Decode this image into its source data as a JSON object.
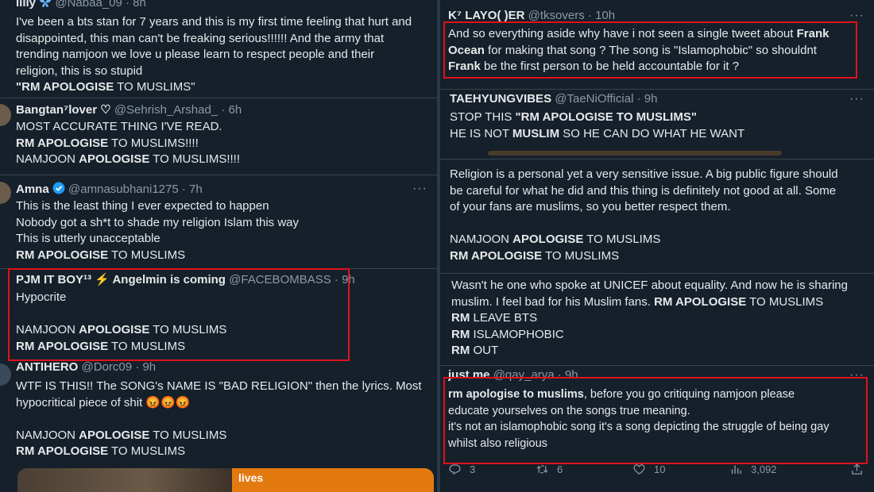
{
  "left": {
    "t1": {
      "name": "lilly",
      "handle": "@Nabaa_09",
      "time": "8h",
      "lines": [
        "I've been a bts stan for 7 years and this is my first time feeling that hurt and",
        "disappointed, this man can't be freaking serious!!!!!! And the army that",
        "trending namjoon we love u please learn to respect people and their",
        "religion, this is so stupid"
      ],
      "last_bold": "\"RM APOLOGISE",
      "last_rest": " TO MUSLIMS\""
    },
    "t2": {
      "name": "Bangtan⁷lover ♡",
      "handle": "@Sehrish_Arshad_",
      "time": "6h",
      "line1": "MOST ACCURATE THING I'VE READ.",
      "line2_bold": "RM APOLOGISE",
      "line2_rest": " TO MUSLIMS!!!!",
      "line3_a": "NAMJOON ",
      "line3_bold": "APOLOGISE",
      "line3_rest": " TO MUSLIMS!!!!"
    },
    "t3": {
      "name": "Amna",
      "handle": "@amnasubhani1275",
      "time": "7h",
      "line1": "This is the least thing I ever expected to happen",
      "line2": "Nobody got a sh*t to shade my religion Islam this way",
      "line3": "This is utterly unacceptable",
      "line4_bold": "RM APOLOGISE",
      "line4_rest": " TO MUSLIMS"
    },
    "t4": {
      "name": "PJM IT BOY¹³ ⚡ Angelmin is coming",
      "handle": "@FACEBOMBASS",
      "time": "9h",
      "line1": "Hypocrite",
      "line2_a": "NAMJOON ",
      "line2_bold": "APOLOGISE",
      "line2_rest": " TO MUSLIMS",
      "line3_bold": "RM APOLOGISE",
      "line3_rest": " TO MUSLIMS"
    },
    "t5": {
      "name": "ANTIHERO",
      "handle": "@Dorc09",
      "time": "9h",
      "line1": "WTF IS THIS!!  The SONG's NAME IS \"BAD RELIGION\" then the lyrics. Most",
      "line2": "hypocritical piece of shit 😡😡😡",
      "line3_a": "NAMJOON ",
      "line3_bold": "APOLOGISE",
      "line3_rest": " TO MUSLIMS",
      "line4_bold": "RM APOLOGISE",
      "line4_rest": " TO MUSLIMS",
      "media_label": "lives"
    }
  },
  "right": {
    "r1": {
      "name": "K⁷ LAYO(  )ER",
      "handle": "@tksovers",
      "time": "10h",
      "l1_a": "And so everything aside why have i not seen a single tweet about ",
      "l1_bold": "Frank",
      "l2_bold": "Ocean",
      "l2_rest": " for making that song ? The song is \"Islamophobic\" so shouldnt",
      "l3_bold": "Frank",
      "l3_rest": " be the first person to be held accountable for it ?"
    },
    "r2": {
      "name": "TAEHYUNGVIBES",
      "handle": "@TaeNiOfficial",
      "time": "9h",
      "l1_a": "STOP THIS ",
      "l1_bold": "\"RM APOLOGISE TO MUSLIMS\"",
      "l2_a": "HE IS NOT ",
      "l2_bold": "MUSLIM",
      "l2_rest": " SO HE CAN DO WHAT HE WANT"
    },
    "r3": {
      "lines": [
        "Religion is a personal yet a very sensitive issue. A big public figure should",
        "be careful for what he did and this thing is definitely not good at all. Some",
        "of your fans are muslims, so you better respect them."
      ],
      "l4_a": "NAMJOON ",
      "l4_bold": "APOLOGISE",
      "l4_rest": " TO MUSLIMS",
      "l5_bold": "RM APOLOGISE",
      "l5_rest": " TO MUSLIMS"
    },
    "r4": {
      "l1": "Wasn't he one who spoke at UNICEF about equality. And now he is sharing",
      "l2_a": "muslim. I feel bad for his Muslim fans. ",
      "l2_bold": "RM APOLOGISE",
      "l2_rest": " TO MUSLIMS",
      "l3_bold": "RM",
      "l3_rest": " LEAVE BTS",
      "l4_bold": "RM",
      "l4_rest": " ISLAMOPHOBIC",
      "l5_bold": "RM",
      "l5_rest": " OUT"
    },
    "r5": {
      "name": "just me",
      "handle": "@qay_arya",
      "time": "9h",
      "l1_bold": "rm apologise to muslims",
      "l1_rest": ", before you go critiquing namjoon please",
      "l2": "educate yourselves on the songs true meaning.",
      "l3": "it's not an islamophobic song it's a song depicting the struggle of being gay",
      "l4": "whilst also religious",
      "replies": "3",
      "retweets": "6",
      "likes": "10",
      "views": "3,092"
    }
  },
  "colors": {
    "highlight_box": "#e0121b",
    "background": "#15202b",
    "muted_text": "#8b98a5",
    "verified": "#1d9bf0"
  },
  "icons": [
    "reply-icon",
    "retweet-icon",
    "like-icon",
    "views-icon",
    "share-icon",
    "verified-badge-icon",
    "butterfly-icon"
  ]
}
